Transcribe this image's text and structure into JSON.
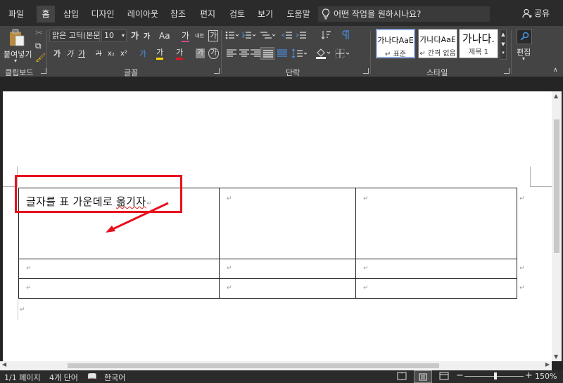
{
  "tabs": [
    {
      "label": "파일"
    },
    {
      "label": "홈"
    },
    {
      "label": "삽입"
    },
    {
      "label": "디자인"
    },
    {
      "label": "레이아웃"
    },
    {
      "label": "참조"
    },
    {
      "label": "편지"
    },
    {
      "label": "검토"
    },
    {
      "label": "보기"
    },
    {
      "label": "도움말"
    }
  ],
  "search": {
    "placeholder": "어떤 작업을 원하시나요?"
  },
  "share": {
    "label": "공유"
  },
  "ribbon": {
    "clipboard": {
      "paste_label": "붙여넣기",
      "group_label": "클립보드"
    },
    "font": {
      "font_name": "맑은 고딕(본문",
      "font_size": "10",
      "grow": "가",
      "shrink": "가",
      "case": "Aa",
      "clear": "가",
      "phonetic": "내천",
      "border_char": "가",
      "bold": "가",
      "italic": "가",
      "underline": "가",
      "strike": "가",
      "subscript": "x₂",
      "superscript": "x²",
      "effects": "가",
      "highlight": "가",
      "color": "가",
      "shade": "가",
      "enclose": "가",
      "group_label": "글꼴"
    },
    "paragraph": {
      "group_label": "단락"
    },
    "styles": {
      "items": [
        {
          "preview": "가나다AaE",
          "name": "↵ 표준"
        },
        {
          "preview": "가나다AaE",
          "name": "↵ 간격 없음"
        },
        {
          "preview": "가나다.",
          "name": "제목 1"
        }
      ],
      "group_label": "스타일"
    },
    "editing": {
      "label": "편집"
    }
  },
  "document": {
    "cell_text": "글자를 표 가운데로 옮기자",
    "paragraph_mark": "↵"
  },
  "status": {
    "page": "1/1 페이지",
    "words": "4개 단어",
    "language": "한국어",
    "zoom": "150%"
  },
  "colors": {
    "annotation": "#e8101e",
    "ribbon": "#444444",
    "tabbar": "#2b2b2b",
    "highlight_yellow": "#ffd800",
    "font_red": "#e81123"
  }
}
